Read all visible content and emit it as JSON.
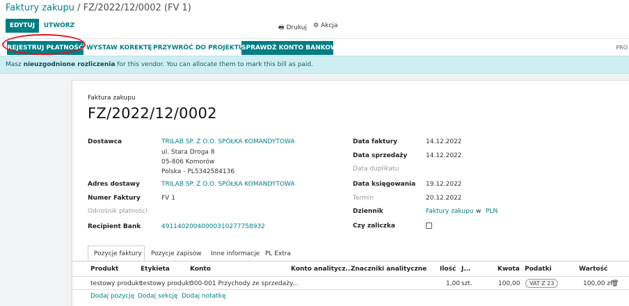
{
  "breadcrumb": {
    "parent": "Faktury zakupu",
    "separator": " / ",
    "current": "FZ/2022/12/0002 (FV 1)"
  },
  "control_panel": {
    "edit_label": "EDYTUJ",
    "create_label": "UTWÓRZ",
    "print_label": "Drukuj",
    "action_label": "Akcja"
  },
  "statusbar": {
    "register_payment": "REJESTRUJ PŁATNOŚĆ",
    "add_credit_note": "WYSTAW KOREKTĘ",
    "reset_to_draft": "PRZYWRÓĆ DO PROJEKTU",
    "check_bank": "SPRAWDŹ KONTO BANKOWE",
    "overflow": "PRO"
  },
  "alert": {
    "prefix": "Masz ",
    "bold": "nieuzgodnione rozliczenia",
    "suffix": " for this vendor. You can allocate them to mark this bill as paid."
  },
  "form": {
    "doc_type": "Faktura zakupu",
    "name": "FZ/2022/12/0002",
    "left": {
      "vendor_label": "Dostawca",
      "vendor_name": "TRILAB SP. Z O.O. SPÓŁKA KOMANDYTOWA",
      "vendor_street": "ul. Stara Droga 8",
      "vendor_city": "05-806 Komorów",
      "vendor_country": "Polska - PL5342584136",
      "delivery_label": "Adres dostawy",
      "delivery_value": "TRILAB SP. Z O.O. SPÓŁKA KOMANDYTOWA",
      "invoice_number_label": "Numer Faktury",
      "invoice_number_value": "FV 1",
      "payment_ref_label": "Odnośnik płatności",
      "recipient_bank_label": "Recipient Bank",
      "recipient_bank_value": "49114020040000310277758932"
    },
    "right": {
      "invoice_date_label": "Data faktury",
      "invoice_date_value": "14.12.2022",
      "sale_date_label": "Data sprzedaży",
      "sale_date_value": "14.12.2022",
      "duplicate_date_label": "Data duplikatu",
      "accounting_date_label": "Data księgowania",
      "accounting_date_value": "19.12.2022",
      "due_label": "Termin",
      "due_value": "20.12.2022",
      "journal_label": "Dziennik",
      "journal_value": "Faktury zakupu",
      "journal_in": "w",
      "currency": "PLN",
      "advance_label": "Czy zaliczka"
    }
  },
  "tabs": [
    "Pozycje faktury",
    "Pozycje zapisów",
    "Inne informacje",
    "PL Extra"
  ],
  "table": {
    "headers": {
      "product": "Produkt",
      "label": "Etykieta",
      "account": "Konto",
      "analytic_account": "Konto analitycz...",
      "analytic_tags": "Znaczniki analityczne",
      "quantity": "Ilość",
      "uom": "J...",
      "price": "Kwota",
      "taxes": "Podatki",
      "subtotal": "Wartość"
    },
    "row": {
      "product": "testowy produkt",
      "label": "testowy produkt",
      "account": "300-001 Przychody ze sprzedaży...",
      "quantity": "1,00",
      "uom": "szt.",
      "price": "100,00",
      "tax": "VAT Z 23",
      "subtotal": "100,00 zł"
    },
    "add_line": "Dodaj pozycję",
    "add_section": "Dodaj sekcję",
    "add_note": "Dodaj notatkę"
  }
}
